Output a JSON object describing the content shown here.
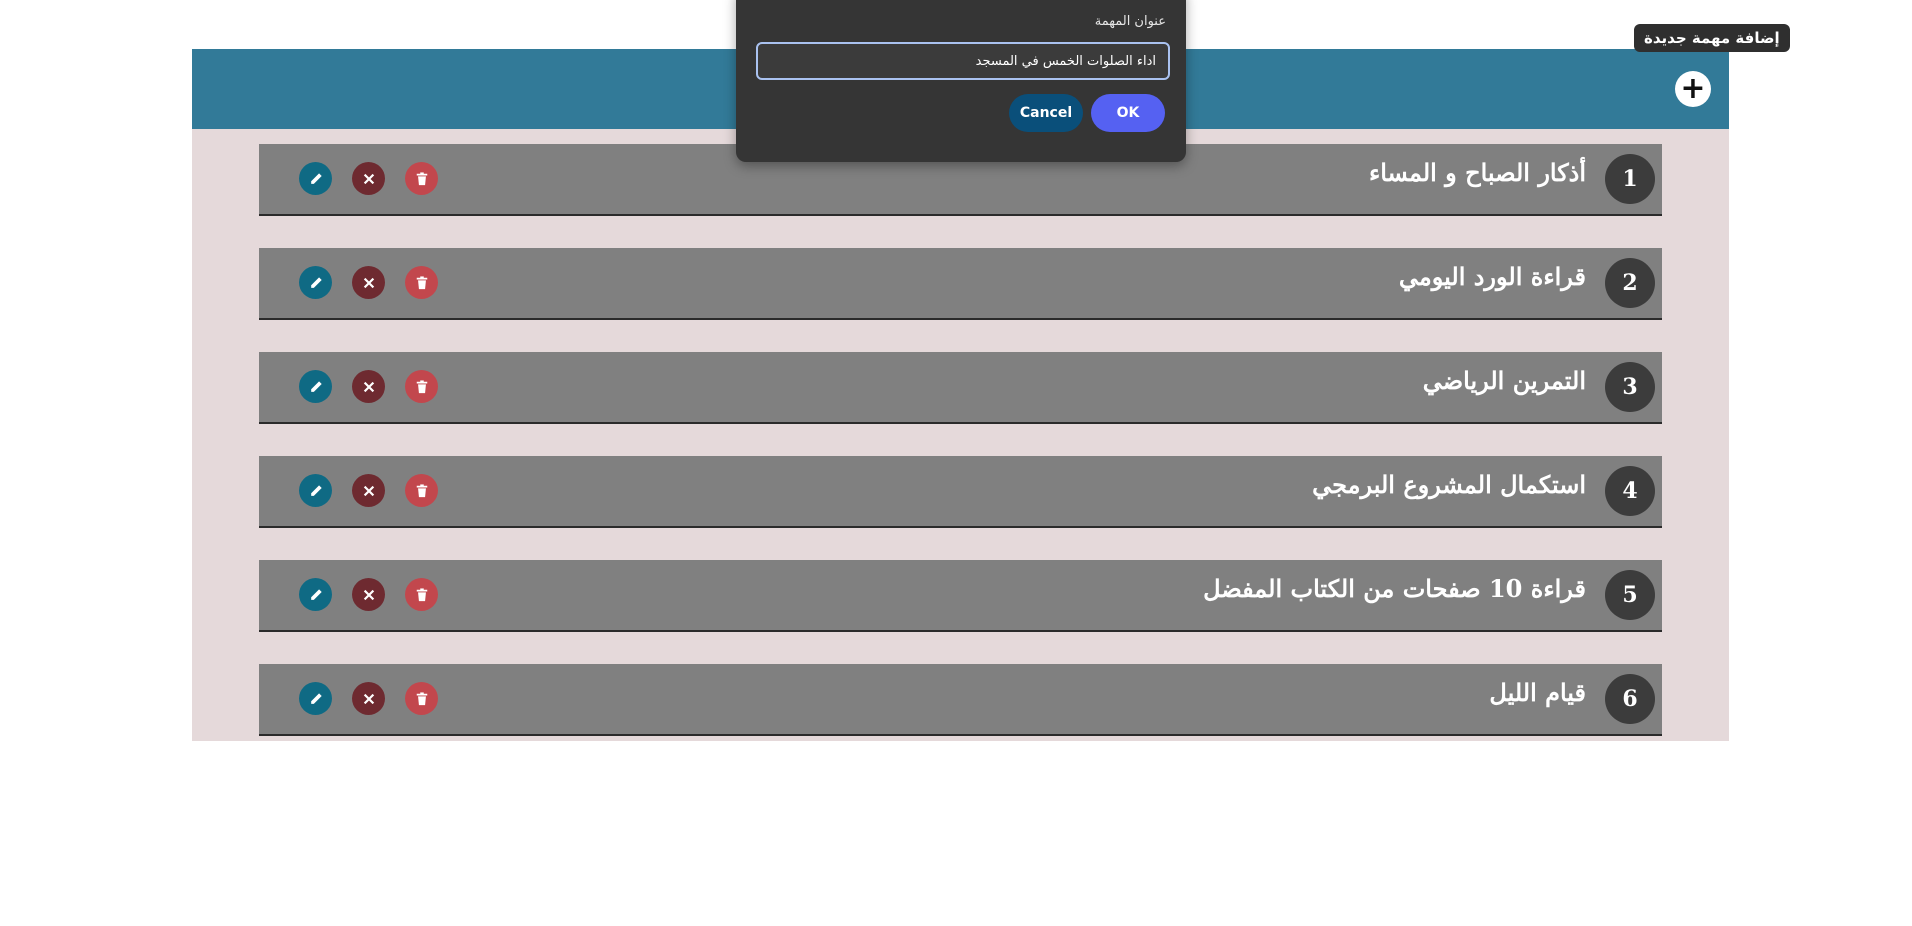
{
  "header": {
    "add_tooltip": "إضافة مهمة جديدة",
    "add_symbol": "+"
  },
  "tasks": [
    {
      "number": "1",
      "title": "أذكار الصباح و المساء"
    },
    {
      "number": "2",
      "title": "قراءة الورد اليومي"
    },
    {
      "number": "3",
      "title": "التمرين الرياضي"
    },
    {
      "number": "4",
      "title": "استكمال المشروع البرمجي"
    },
    {
      "number": "5",
      "title": "قراءة 10 صفحات من الكتاب المفضل"
    },
    {
      "number": "6",
      "title": "قيام الليل"
    }
  ],
  "dialog": {
    "label": "عنوان المهمة",
    "input_value": "اداء الصلوات الخمس في المسجد",
    "cancel_label": "Cancel",
    "ok_label": "OK"
  },
  "colors": {
    "header": "#327a98",
    "background": "#e5d9da",
    "task": "#808080",
    "edit": "#0f6a84",
    "cancel": "#6e2a30",
    "delete": "#c2474d",
    "ok": "#5561f2"
  },
  "icons": [
    "plus-icon",
    "pencil-icon",
    "close-icon",
    "trash-icon"
  ]
}
